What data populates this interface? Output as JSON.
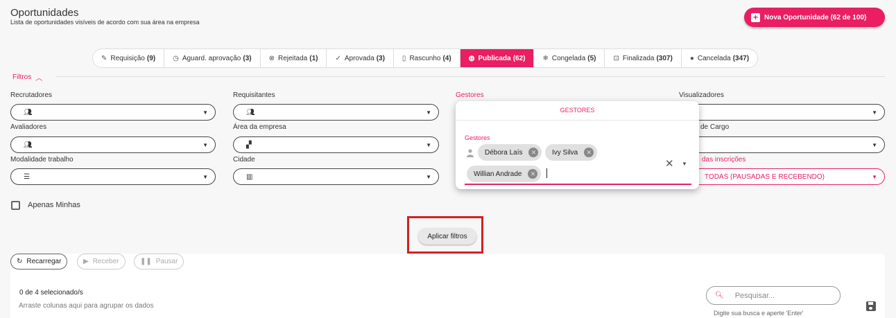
{
  "header": {
    "title": "Oportunidades",
    "subtitle": "Lista de oportunidades visíveis de acordo com sua área na empresa",
    "new_button_label": "Nova Oportunidade",
    "new_button_count": "(62 de 100)"
  },
  "tabs": [
    {
      "label": "Requisição",
      "count": "(9)",
      "icon": "edit-icon",
      "glyph": "✎",
      "active": false
    },
    {
      "label": "Aguard. aprovação",
      "count": "(3)",
      "icon": "clock-icon",
      "glyph": "◷",
      "active": false
    },
    {
      "label": "Rejeitada",
      "count": "(1)",
      "icon": "cancel-circle-icon",
      "glyph": "⊗",
      "active": false
    },
    {
      "label": "Aprovada",
      "count": "(3)",
      "icon": "check-circle-icon",
      "glyph": "✓",
      "active": false
    },
    {
      "label": "Rascunho",
      "count": "(4)",
      "icon": "document-icon",
      "glyph": "▯",
      "active": false
    },
    {
      "label": "Publicada",
      "count": "(62)",
      "icon": "globe-icon",
      "glyph": "◍",
      "active": true
    },
    {
      "label": "Congelada",
      "count": "(5)",
      "icon": "snowflake-icon",
      "glyph": "❄",
      "active": false
    },
    {
      "label": "Finalizada",
      "count": "(307)",
      "icon": "lock-icon",
      "glyph": "⊡",
      "active": false
    },
    {
      "label": "Cancelada",
      "count": "(347)",
      "icon": "stop-circle-icon",
      "glyph": "●",
      "active": false
    }
  ],
  "filters": {
    "toggle_label": "Filtros",
    "recrutadores": "Recrutadores",
    "requisitantes": "Requisitantes",
    "gestores": "Gestores",
    "visualizadores": "Visualizadores",
    "avaliadores": "Avaliadores",
    "area_empresa": "Área da empresa",
    "cargo_partial": "de Cargo",
    "modalidade": "Modalidade trabalho",
    "cidade": "Cidade",
    "inscricoes_partial": "das inscrições",
    "inscricoes_value": "TODAS (PAUSADAS E RECEBENDO)",
    "only_mine": "Apenas Minhas",
    "apply": "Aplicar filtros"
  },
  "gestores_popup": {
    "title": "GESTORES",
    "label": "Gestores",
    "chips": [
      "Débora Laís",
      "Ivy Silva",
      "Willian Andrade"
    ]
  },
  "toolbar": {
    "reload": "Recarregar",
    "receive": "Receber",
    "pause": "Pausar"
  },
  "grid": {
    "selection": "0 de 4 selecionado/s",
    "group_hint": "Arraste colunas aqui para agrupar os dados",
    "search_placeholder": "Pesquisar...",
    "search_hint": "Digite sua busca e aperte 'Enter'"
  },
  "colors": {
    "accent": "#e91e63",
    "highlight_frame": "#d32020"
  }
}
